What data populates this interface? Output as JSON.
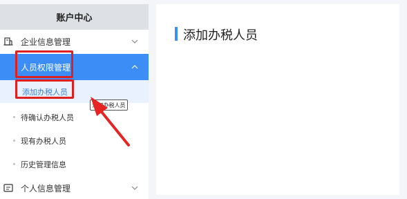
{
  "sidebar": {
    "header": "账户中心",
    "items": {
      "company": {
        "label": "企业信息管理",
        "icon": "building-icon",
        "expanded": false
      },
      "permissions": {
        "label": "人员权限管理",
        "icon": "user-icon",
        "expanded": true
      },
      "personal": {
        "label": "个人信息管理",
        "icon": "profile-card-icon",
        "expanded": false
      }
    },
    "sub_items": {
      "add": {
        "label": "添加办税人员",
        "active": true
      },
      "pending": {
        "label": "待确认办税人员"
      },
      "existing": {
        "label": "现有办税人员"
      },
      "history": {
        "label": "历史管理信息"
      }
    }
  },
  "tooltip": {
    "text": "添加办税人员"
  },
  "main": {
    "title": "添加办税人员"
  },
  "colors": {
    "accent": "#3c8df6",
    "highlight": "#e02020",
    "active_sub_bg": "#e8f1fd"
  }
}
